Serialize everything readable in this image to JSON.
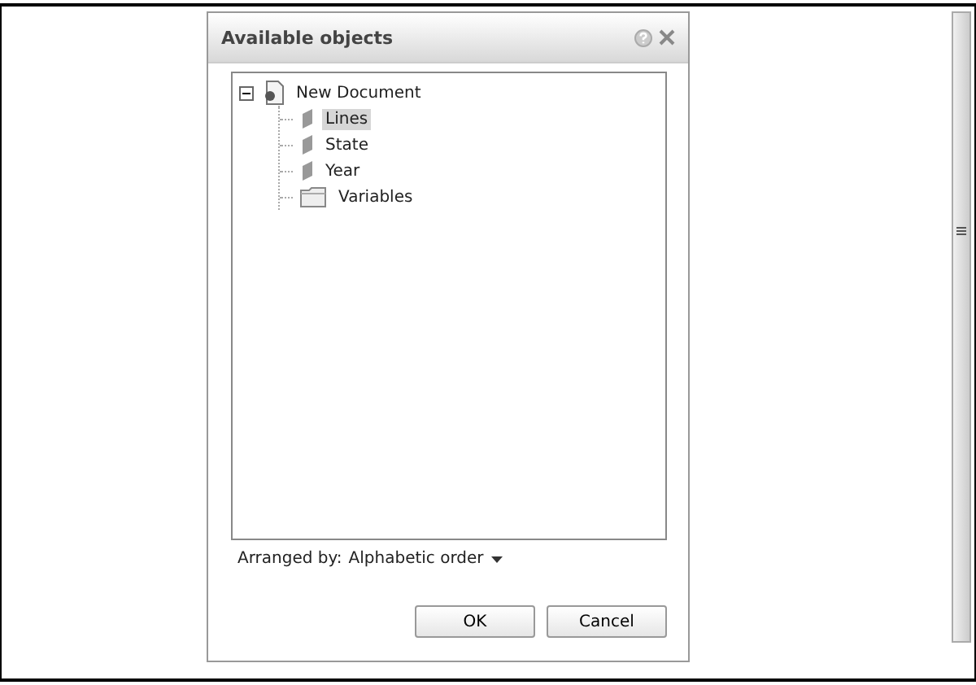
{
  "dialog": {
    "title": "Available objects",
    "tree": [
      {
        "label": "New Document",
        "kind": "document",
        "expanded": true,
        "selected": false,
        "children": [
          {
            "label": "Lines",
            "kind": "dimension",
            "selected": true
          },
          {
            "label": "State",
            "kind": "dimension",
            "selected": false
          },
          {
            "label": "Year",
            "kind": "dimension",
            "selected": false
          },
          {
            "label": "Variables",
            "kind": "folder",
            "selected": false
          }
        ]
      }
    ],
    "arranged_by": {
      "label": "Arranged by:",
      "value": "Alphabetic order"
    },
    "buttons": [
      "OK",
      "Cancel"
    ]
  }
}
